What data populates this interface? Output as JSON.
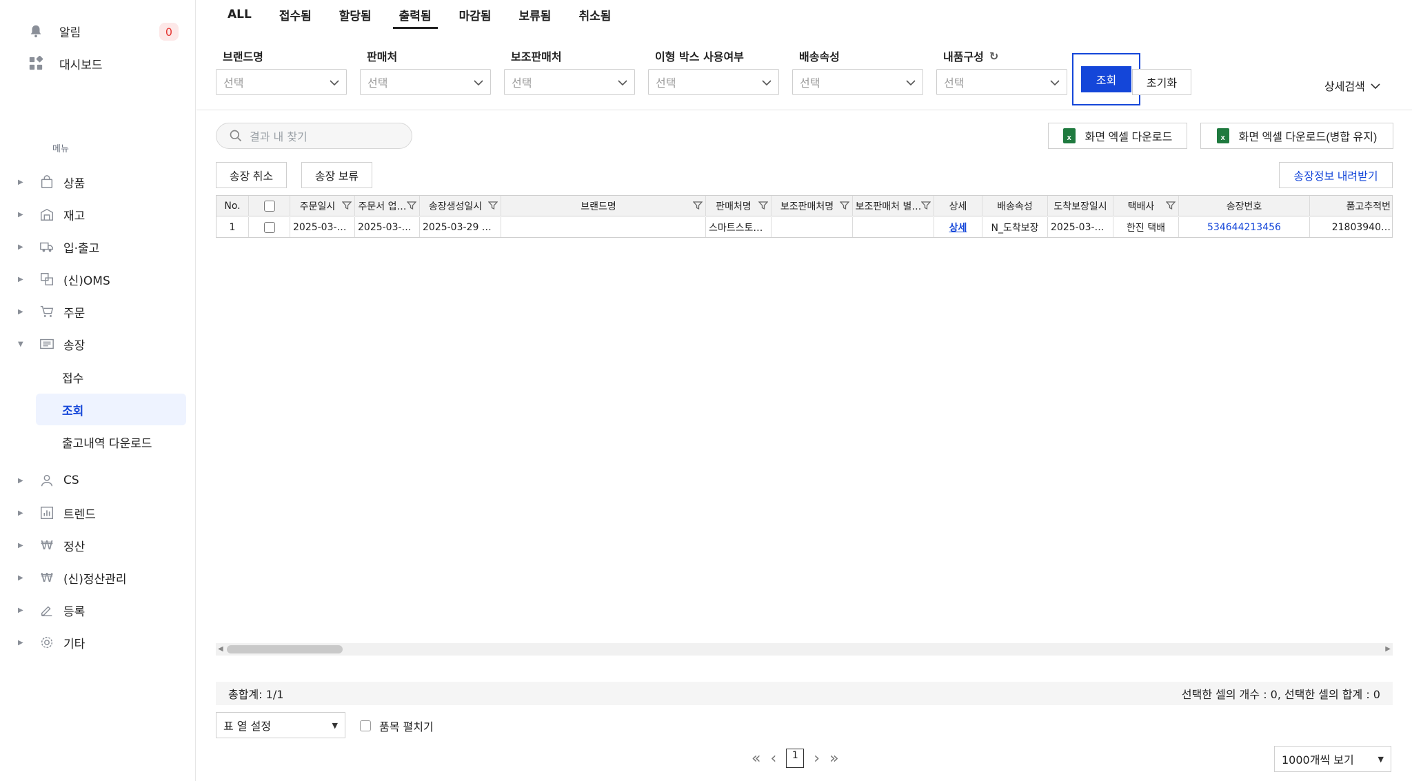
{
  "sidebar": {
    "alarm_label": "알림",
    "alarm_count": "0",
    "dashboard_label": "대시보드",
    "menu_caption": "메뉴",
    "nav": [
      {
        "label": "상품",
        "icon": "bag-icon"
      },
      {
        "label": "재고",
        "icon": "warehouse-icon"
      },
      {
        "label": "입·출고",
        "icon": "truck-icon"
      },
      {
        "label": "(신)OMS",
        "icon": "oms-icon"
      },
      {
        "label": "주문",
        "icon": "cart-icon"
      },
      {
        "label": "송장",
        "icon": "invoice-icon"
      },
      {
        "label": "CS",
        "icon": "person-icon"
      },
      {
        "label": "트렌드",
        "icon": "bar-chart-icon"
      },
      {
        "label": "정산",
        "icon": "won-icon"
      },
      {
        "label": "(신)정산관리",
        "icon": "won-icon"
      },
      {
        "label": "등록",
        "icon": "pencil-icon"
      },
      {
        "label": "기타",
        "icon": "gear-icon"
      }
    ],
    "sub_items": [
      "접수",
      "조회",
      "출고내역 다운로드"
    ]
  },
  "tabs": [
    "ALL",
    "접수됨",
    "할당됨",
    "출력됨",
    "마감됨",
    "보류됨",
    "취소됨"
  ],
  "filters": [
    {
      "label": "브랜드명",
      "placeholder": "선택"
    },
    {
      "label": "판매처",
      "placeholder": "선택"
    },
    {
      "label": "보조판매처",
      "placeholder": "선택"
    },
    {
      "label": "이형 박스 사용여부",
      "placeholder": "선택"
    },
    {
      "label": "배송속성",
      "placeholder": "선택"
    },
    {
      "label": "내품구성",
      "placeholder": "선택"
    }
  ],
  "buttons": {
    "query": "조회",
    "reset": "초기화",
    "advanced": "상세검색",
    "excel": "화면 엑셀 다운로드",
    "excel_merge": "화면 엑셀 다운로드(병합 유지)",
    "cancel_invoice": "송장 취소",
    "hold_invoice": "송장 보류",
    "download_invoice": "송장정보 내려받기"
  },
  "search": {
    "placeholder": "결과 내 찾기"
  },
  "grid": {
    "headers": [
      "No.",
      "",
      "주문일시",
      "주문서 업…",
      "송장생성일시",
      "브랜드명",
      "판매처명",
      "보조판매처명",
      "보조판매처 별…",
      "상세",
      "배송속성",
      "도착보장일시",
      "택배사",
      "송장번호",
      "품고추적번"
    ],
    "row": [
      "1",
      "",
      "2025-03-…",
      "2025-03-…",
      "2025-03-29 …",
      "",
      "스마트스토…",
      "",
      "",
      "상세",
      "N_도착보장",
      "2025-03-…",
      "한진 택배",
      "534644213456",
      "21803940…"
    ]
  },
  "summary": {
    "total": "총합계: 1/1",
    "selection": "선택한 셀의 개수 : 0, 선택한 셀의 합계 : 0"
  },
  "footer": {
    "column_setting": "표 열 설정",
    "expand_items": "품목 펼치기",
    "current_page": "1",
    "page_size": "1000개씩 보기"
  },
  "colors": {
    "accent": "#1446d9",
    "badge": "#e53935",
    "excel": "#1f7a3f"
  }
}
